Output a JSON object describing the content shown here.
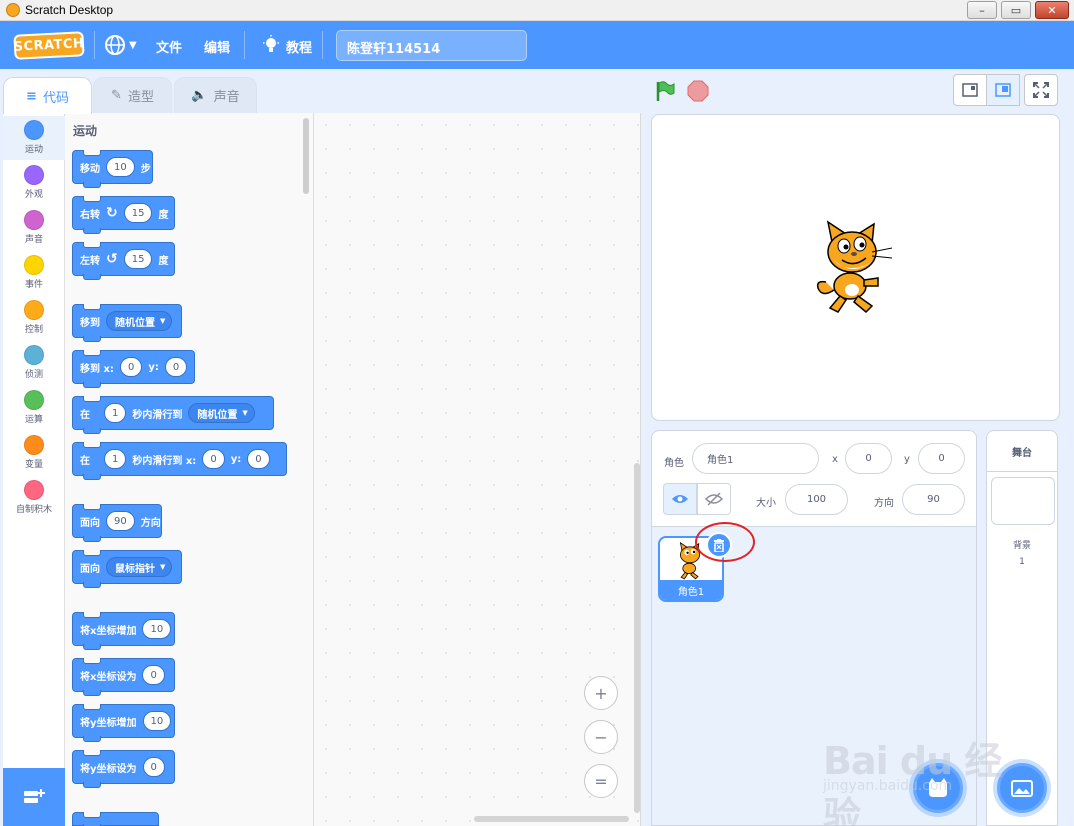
{
  "window": {
    "title": "Scratch Desktop",
    "min_glyph": "–",
    "max_glyph": "▭",
    "close_glyph": "✕"
  },
  "menubar": {
    "logo_text": "SCRATCH",
    "items": [
      {
        "label": "文件"
      },
      {
        "label": "编辑"
      },
      {
        "label": "教程"
      }
    ],
    "project_title": "陈登轩114514"
  },
  "tabs": [
    {
      "label": "代码",
      "active": true
    },
    {
      "label": "造型",
      "active": false
    },
    {
      "label": "声音",
      "active": false
    }
  ],
  "categories": [
    {
      "label": "运动",
      "color": "#4c97ff"
    },
    {
      "label": "外观",
      "color": "#9966ff"
    },
    {
      "label": "声音",
      "color": "#cf63cf"
    },
    {
      "label": "事件",
      "color": "#ffd500"
    },
    {
      "label": "控制",
      "color": "#ffab19"
    },
    {
      "label": "侦测",
      "color": "#5cb1d6"
    },
    {
      "label": "运算",
      "color": "#59c059"
    },
    {
      "label": "变量",
      "color": "#ff8c1a"
    },
    {
      "label": "自制积木",
      "color": "#ff6680"
    }
  ],
  "flyout": {
    "category_title": "运动",
    "blocks": {
      "move": {
        "a": "移动",
        "v": "10",
        "b": "步"
      },
      "turn_right": {
        "a": "右转",
        "v": "15",
        "b": "度"
      },
      "turn_left": {
        "a": "左转",
        "v": "15",
        "b": "度"
      },
      "goto": {
        "a": "移到",
        "dd": "随机位置"
      },
      "goto_xy": {
        "a": "移到 x:",
        "x": "0",
        "b": "y:",
        "y": "0"
      },
      "glide": {
        "a": "在",
        "v": "1",
        "b": "秒内滑行到",
        "dd": "随机位置"
      },
      "glide_xy": {
        "a": "在",
        "v": "1",
        "b": "秒内滑行到 x:",
        "x": "0",
        "c": "y:",
        "y": "0"
      },
      "point_dir": {
        "a": "面向",
        "v": "90",
        "b": "方向"
      },
      "point_towards": {
        "a": "面向",
        "dd": "鼠标指针"
      },
      "change_x": {
        "a": "将x坐标增加",
        "v": "10"
      },
      "set_x": {
        "a": "将x坐标设为",
        "v": "0"
      },
      "change_y": {
        "a": "将y坐标增加",
        "v": "10"
      },
      "set_y": {
        "a": "将y坐标设为",
        "v": "0"
      }
    }
  },
  "zoom": {
    "in": "+",
    "out": "−",
    "reset": "="
  },
  "sprite_info": {
    "sprite_label": "角色",
    "sprite_name": "角色1",
    "x_label": "x",
    "x_value": "0",
    "y_label": "y",
    "y_value": "0",
    "size_label": "大小",
    "size_value": "100",
    "direction_label": "方向",
    "direction_value": "90"
  },
  "sprites": [
    {
      "name": "角色1",
      "selected": true
    }
  ],
  "stage_panel": {
    "title": "舞台",
    "backdrop_label": "背景",
    "backdrop_count": "1"
  },
  "watermark": {
    "main": "Bai du 经验",
    "url": "jingyan.baidu.com"
  },
  "colors": {
    "accent": "#4c97ff",
    "motion": "#4c97ff",
    "highlight": "#e0222b"
  }
}
